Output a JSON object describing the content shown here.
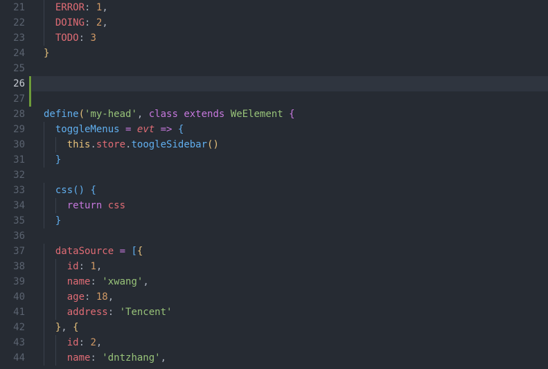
{
  "editor": {
    "active_line": 26,
    "modified_lines": [
      26,
      27
    ],
    "lines": [
      {
        "n": "21",
        "indent": 1,
        "tokens": [
          [
            "prop",
            "ERROR"
          ],
          [
            "punc",
            ": "
          ],
          [
            "num",
            "1"
          ],
          [
            "punc",
            ","
          ]
        ]
      },
      {
        "n": "22",
        "indent": 1,
        "tokens": [
          [
            "prop",
            "DOING"
          ],
          [
            "punc",
            ": "
          ],
          [
            "num",
            "2"
          ],
          [
            "punc",
            ","
          ]
        ]
      },
      {
        "n": "23",
        "indent": 1,
        "tokens": [
          [
            "prop",
            "TODO"
          ],
          [
            "punc",
            ": "
          ],
          [
            "num",
            "3"
          ]
        ]
      },
      {
        "n": "24",
        "indent": 0,
        "tokens": [
          [
            "b1",
            "}"
          ]
        ]
      },
      {
        "n": "25",
        "indent": 0,
        "tokens": []
      },
      {
        "n": "26",
        "indent": 0,
        "tokens": []
      },
      {
        "n": "27",
        "indent": 0,
        "tokens": []
      },
      {
        "n": "28",
        "indent": 0,
        "tokens": [
          [
            "func",
            "define"
          ],
          [
            "b1",
            "("
          ],
          [
            "str",
            "'my-head'"
          ],
          [
            "punc",
            ", "
          ],
          [
            "kw",
            "class"
          ],
          [
            "plain",
            " "
          ],
          [
            "kw",
            "extends"
          ],
          [
            "plain",
            " "
          ],
          [
            "cls",
            "WeElement"
          ],
          [
            "plain",
            " "
          ],
          [
            "b2",
            "{"
          ]
        ]
      },
      {
        "n": "29",
        "indent": 1,
        "tokens": [
          [
            "func",
            "toggleMenus"
          ],
          [
            "plain",
            " "
          ],
          [
            "op",
            "="
          ],
          [
            "plain",
            " "
          ],
          [
            "param",
            "evt"
          ],
          [
            "plain",
            " "
          ],
          [
            "op",
            "=>"
          ],
          [
            "plain",
            " "
          ],
          [
            "b3",
            "{"
          ]
        ]
      },
      {
        "n": "30",
        "indent": 2,
        "tokens": [
          [
            "this",
            "this"
          ],
          [
            "punc",
            "."
          ],
          [
            "prop",
            "store"
          ],
          [
            "punc",
            "."
          ],
          [
            "func",
            "toogleSidebar"
          ],
          [
            "b1",
            "()"
          ]
        ]
      },
      {
        "n": "31",
        "indent": 1,
        "tokens": [
          [
            "b3",
            "}"
          ]
        ]
      },
      {
        "n": "32",
        "indent": 0,
        "tokens": []
      },
      {
        "n": "33",
        "indent": 1,
        "tokens": [
          [
            "func",
            "css"
          ],
          [
            "b3",
            "()"
          ],
          [
            "plain",
            " "
          ],
          [
            "b3",
            "{"
          ]
        ]
      },
      {
        "n": "34",
        "indent": 2,
        "tokens": [
          [
            "kw",
            "return"
          ],
          [
            "plain",
            " "
          ],
          [
            "prop",
            "css"
          ]
        ]
      },
      {
        "n": "35",
        "indent": 1,
        "tokens": [
          [
            "b3",
            "}"
          ]
        ]
      },
      {
        "n": "36",
        "indent": 0,
        "tokens": []
      },
      {
        "n": "37",
        "indent": 1,
        "tokens": [
          [
            "prop",
            "dataSource"
          ],
          [
            "plain",
            " "
          ],
          [
            "op",
            "="
          ],
          [
            "plain",
            " "
          ],
          [
            "b3",
            "["
          ],
          [
            "b1",
            "{"
          ]
        ]
      },
      {
        "n": "38",
        "indent": 2,
        "tokens": [
          [
            "prop",
            "id"
          ],
          [
            "punc",
            ": "
          ],
          [
            "num",
            "1"
          ],
          [
            "punc",
            ","
          ]
        ]
      },
      {
        "n": "39",
        "indent": 2,
        "tokens": [
          [
            "prop",
            "name"
          ],
          [
            "punc",
            ": "
          ],
          [
            "str",
            "'xwang'"
          ],
          [
            "punc",
            ","
          ]
        ]
      },
      {
        "n": "40",
        "indent": 2,
        "tokens": [
          [
            "prop",
            "age"
          ],
          [
            "punc",
            ": "
          ],
          [
            "num",
            "18"
          ],
          [
            "punc",
            ","
          ]
        ]
      },
      {
        "n": "41",
        "indent": 2,
        "tokens": [
          [
            "prop",
            "address"
          ],
          [
            "punc",
            ": "
          ],
          [
            "str",
            "'Tencent'"
          ]
        ]
      },
      {
        "n": "42",
        "indent": 1,
        "tokens": [
          [
            "b1",
            "}"
          ],
          [
            "punc",
            ", "
          ],
          [
            "b1",
            "{"
          ]
        ]
      },
      {
        "n": "43",
        "indent": 2,
        "tokens": [
          [
            "prop",
            "id"
          ],
          [
            "punc",
            ": "
          ],
          [
            "num",
            "2"
          ],
          [
            "punc",
            ","
          ]
        ]
      },
      {
        "n": "44",
        "indent": 2,
        "tokens": [
          [
            "prop",
            "name"
          ],
          [
            "punc",
            ": "
          ],
          [
            "str",
            "'dntzhang'"
          ],
          [
            "punc",
            ","
          ]
        ]
      }
    ]
  }
}
